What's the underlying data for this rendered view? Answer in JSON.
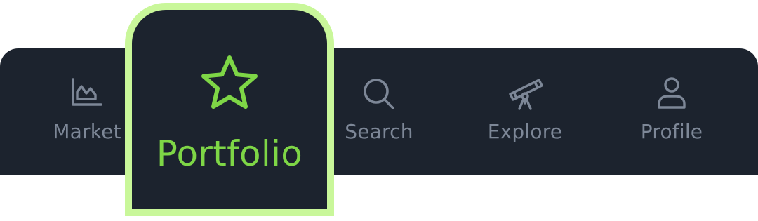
{
  "tabbar": {
    "tabs": [
      {
        "id": "market",
        "label": "Market",
        "icon": "area-chart-icon",
        "active": false
      },
      {
        "id": "portfolio",
        "label": "Portfolio",
        "icon": "star-icon",
        "active": true
      },
      {
        "id": "search",
        "label": "Search",
        "icon": "search-icon",
        "active": false
      },
      {
        "id": "explore",
        "label": "Explore",
        "icon": "telescope-icon",
        "active": false
      },
      {
        "id": "profile",
        "label": "Profile",
        "icon": "user-icon",
        "active": false
      }
    ]
  },
  "colors": {
    "bar_background": "#1c232e",
    "inactive": "#7d8797",
    "active_accent": "#7ed646",
    "active_highlight": "#c9f79a",
    "page_background": "#ffffff"
  }
}
